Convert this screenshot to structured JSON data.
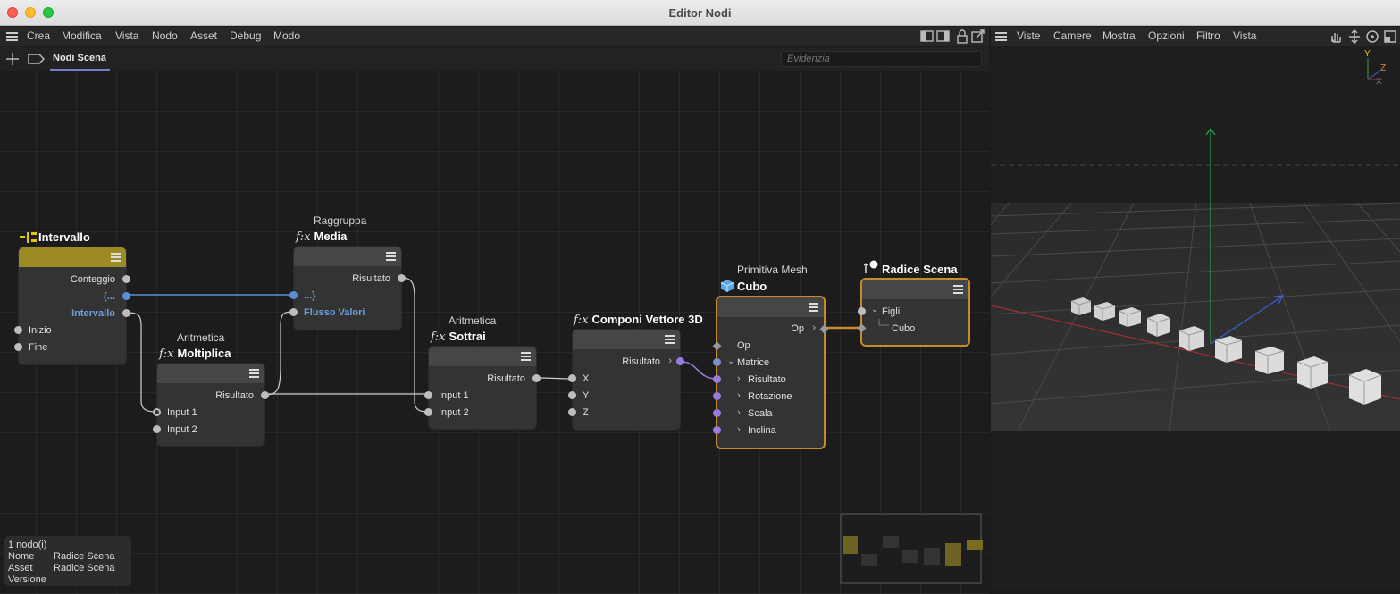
{
  "window": {
    "title": "Editor Nodi"
  },
  "menu": [
    "Crea",
    "Modifica",
    "Vista",
    "Nodo",
    "Asset",
    "Debug",
    "Modo"
  ],
  "tab": {
    "label": "Nodi Scena"
  },
  "search": {
    "placeholder": "Evidenzia"
  },
  "viewport_menu": [
    "Viste",
    "Camere",
    "Mostra",
    "Opzioni",
    "Filtro",
    "Vista"
  ],
  "axis": {
    "y": "Y",
    "z": "Z",
    "x": "X"
  },
  "nodes": {
    "intervallo": {
      "title": "Intervallo",
      "ports": [
        "Conteggio",
        "{...",
        "Intervallo",
        "Inizio",
        "Fine"
      ]
    },
    "media": {
      "subtitle": "Raggruppa",
      "fx": "f:x",
      "title": "Media",
      "ports": [
        "Risultato",
        "...}",
        "Flusso Valori"
      ]
    },
    "moltiplica": {
      "subtitle": "Aritmetica",
      "fx": "f:x",
      "title": "Moltiplica",
      "ports": [
        "Risultato",
        "Input 1",
        "Input 2"
      ]
    },
    "sottrai": {
      "subtitle": "Aritmetica",
      "fx": "f:x",
      "title": "Sottrai",
      "ports": [
        "Risultato",
        "Input 1",
        "Input 2"
      ]
    },
    "componi": {
      "fx": "f:x",
      "title": "Componi Vettore 3D",
      "ports": [
        "Risultato",
        "X",
        "Y",
        "Z"
      ]
    },
    "cubo": {
      "subtitle": "Primitiva Mesh",
      "title": "Cubo",
      "ports": [
        "Op",
        "Op",
        "Matrice",
        "Risultato",
        "Rotazione",
        "Scala",
        "Inclina"
      ]
    },
    "radice": {
      "title": "Radice Scena",
      "ports": [
        "Figli",
        "Cubo"
      ]
    }
  },
  "info": {
    "count": "1 nodo(i)",
    "rows": [
      {
        "label": "Nome",
        "value": "Radice Scena"
      },
      {
        "label": "Asset",
        "value": "Radice Scena"
      },
      {
        "label": "Versione",
        "value": ""
      }
    ]
  },
  "colors": {
    "accent": "#c98a2a",
    "intervallo_header": "#9c8a22",
    "link_blue": "#5b8fd6",
    "link_purple": "#9a7be0"
  }
}
